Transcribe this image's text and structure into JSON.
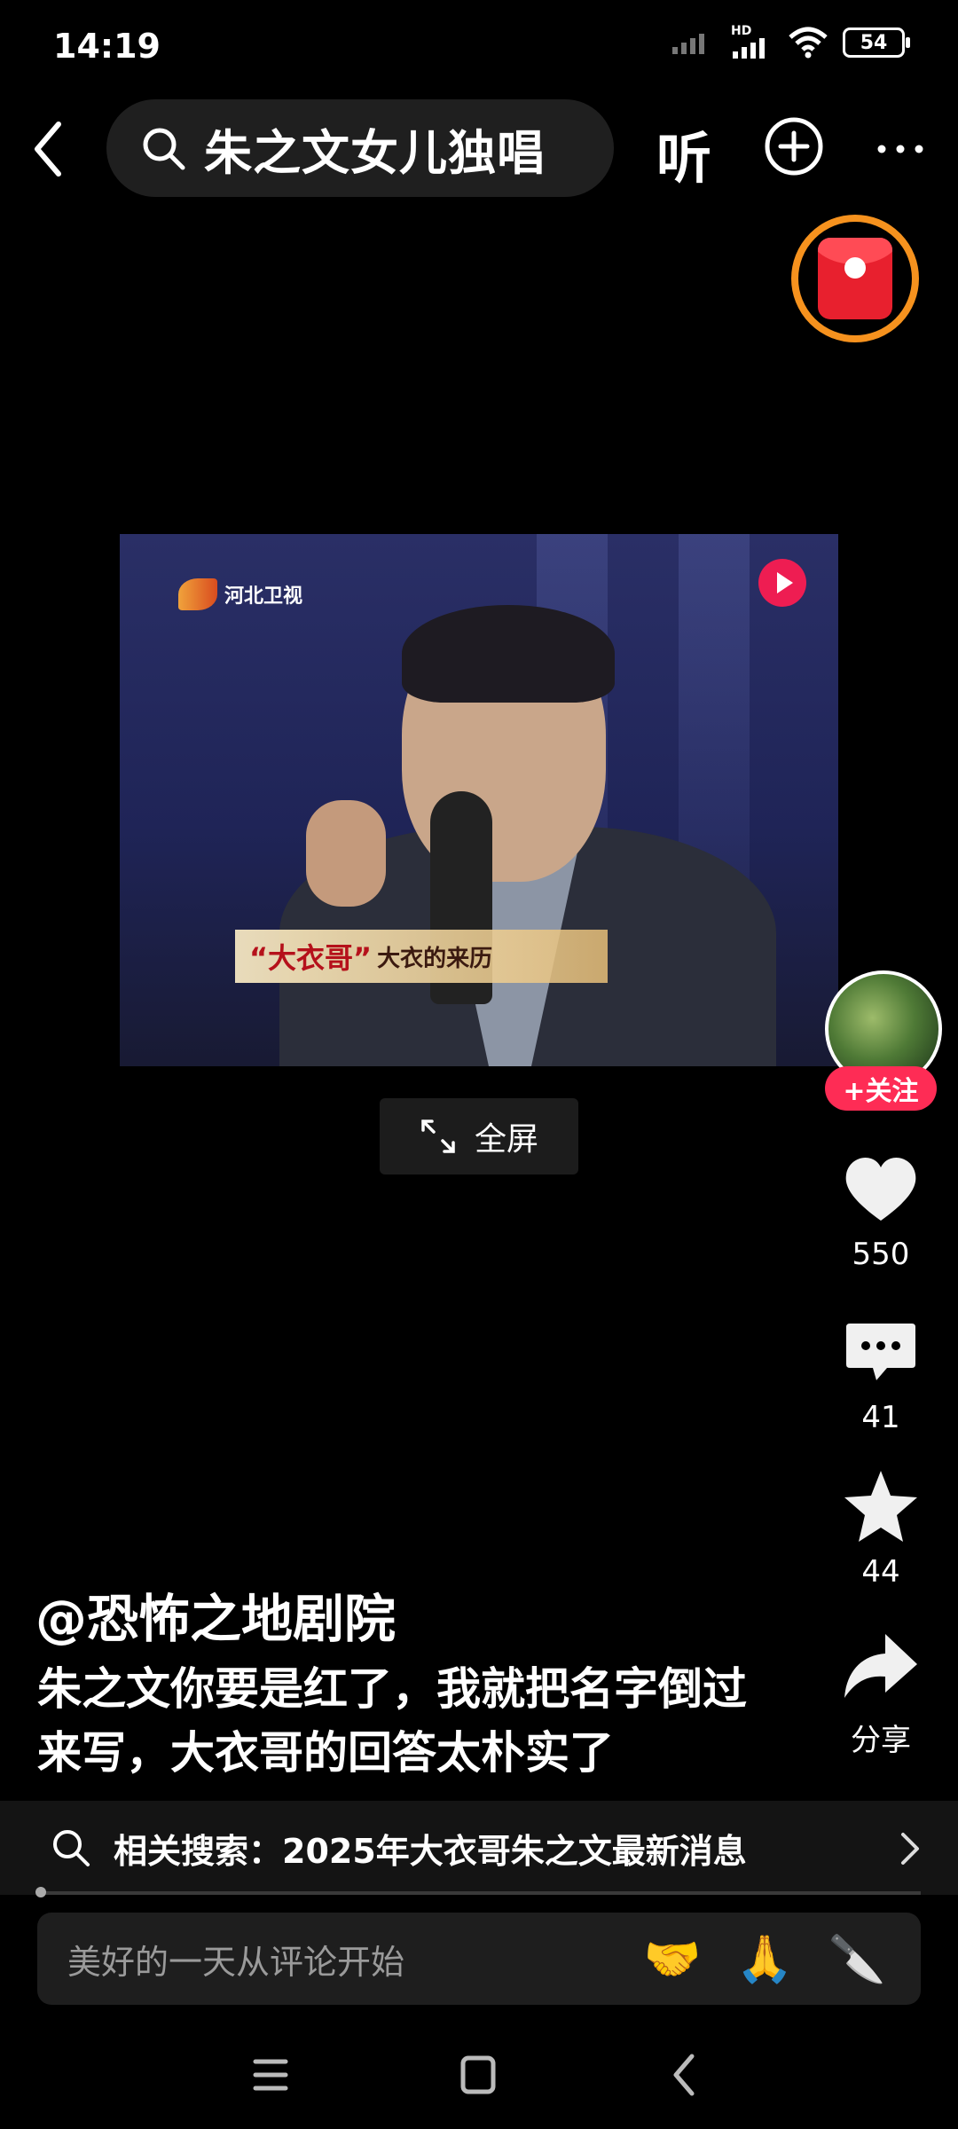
{
  "status_bar": {
    "time": "14:19",
    "network_label": "HD",
    "battery": "54"
  },
  "top_bar": {
    "search_query": "朱之文女儿独唱",
    "listen_label": "听"
  },
  "video": {
    "channel": "河北卫视",
    "caption_main": "“大衣哥”",
    "caption_sub": "大衣的来历",
    "fullscreen_label": "全屏"
  },
  "rail": {
    "follow_label": "+关注",
    "like_count": "550",
    "comment_count": "41",
    "favorite_count": "44",
    "share_label": "分享"
  },
  "post": {
    "author": "@恐怖之地剧院",
    "description": "朱之文你要是红了，我就把名字倒过来写，大衣哥的回答太朴实了"
  },
  "related_search": {
    "text": "相关搜索：2025年大衣哥朱之文最新消息"
  },
  "comment_bar": {
    "placeholder": "美好的一天从评论开始",
    "emojis": [
      "🤝",
      "🙏",
      "🔪"
    ]
  },
  "colors": {
    "accent": "#fe2c55",
    "redpacket_ring": "#f6921e"
  }
}
